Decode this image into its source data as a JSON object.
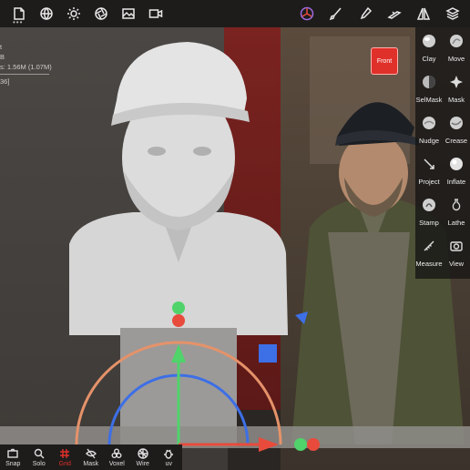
{
  "top_toolbar": {
    "left_icons": [
      "file-icon",
      "globe-icon",
      "sun-icon",
      "aperture-icon",
      "image-icon",
      "video-icon"
    ],
    "right_icons": [
      "gizmo-icon",
      "brush-icon",
      "dropper-icon",
      "tweezer-icon",
      "symmetry-icon",
      "layers-icon"
    ],
    "more_dots": "•••"
  },
  "stats": {
    "line1": "t",
    "line2": "B",
    "line3": "s: 1.56M (1.07M)",
    "line4": "36]"
  },
  "front_button": {
    "label": "Front",
    "color": "#e0302a"
  },
  "tools": [
    {
      "label": "Clay",
      "icon": "clay-icon"
    },
    {
      "label": "Move",
      "icon": "move-icon"
    },
    {
      "label": "SelMask",
      "icon": "selmask-icon"
    },
    {
      "label": "Mask",
      "icon": "mask-icon"
    },
    {
      "label": "Nudge",
      "icon": "nudge-icon"
    },
    {
      "label": "Crease",
      "icon": "crease-icon"
    },
    {
      "label": "Project",
      "icon": "project-icon"
    },
    {
      "label": "Inflate",
      "icon": "inflate-icon"
    },
    {
      "label": "Stamp",
      "icon": "stamp-icon"
    },
    {
      "label": "Lathe",
      "icon": "lathe-icon"
    },
    {
      "label": "Measure",
      "icon": "measure-icon"
    },
    {
      "label": "View",
      "icon": "camera-icon"
    }
  ],
  "bottom_toolbar": [
    {
      "label": "Snap",
      "icon": "snap-icon",
      "active": false
    },
    {
      "label": "Solo",
      "icon": "search-icon",
      "active": false
    },
    {
      "label": "Grid",
      "icon": "grid-icon",
      "active": true
    },
    {
      "label": "Mask",
      "icon": "eye-slash-icon",
      "active": false
    },
    {
      "label": "Voxel",
      "icon": "voxel-icon",
      "active": false
    },
    {
      "label": "Wire",
      "icon": "wire-icon",
      "active": false
    },
    {
      "label": "uv",
      "icon": "bug-icon",
      "active": false
    }
  ],
  "colors": {
    "accent_red": "#e0302a",
    "gizmo_x": "#e84b3c",
    "gizmo_y": "#4fd36a",
    "gizmo_z": "#3d6fe6",
    "gizmo_ring": "#e5926a"
  }
}
